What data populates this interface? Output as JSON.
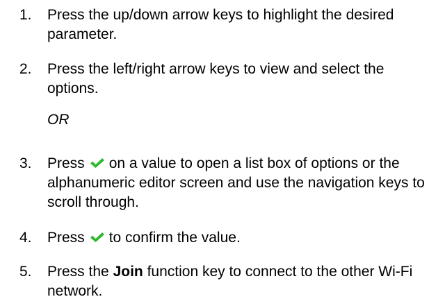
{
  "steps": [
    {
      "number": "1.",
      "text": "Press the up/down arrow keys to highlight the desired parameter."
    },
    {
      "number": "2.",
      "text": "Press the left/right arrow keys to view and select the options."
    },
    {
      "number": "3.",
      "text_before_icon": "Press",
      "icon": "checkmark-icon",
      "text_after_icon": "on a value to open a list box of options or the alphanumeric editor screen and use the navigation keys to scroll through."
    },
    {
      "number": "4.",
      "text_before_icon": "Press",
      "icon": "checkmark-icon",
      "text_after_icon": "to confirm the value."
    },
    {
      "number": "5.",
      "text_before_bold": "Press the",
      "bold": "Join",
      "text_after_bold": "function key to connect to the other Wi-Fi network."
    }
  ],
  "or_text": "OR",
  "colors": {
    "checkmark": "#2db82d",
    "text": "#000000"
  }
}
